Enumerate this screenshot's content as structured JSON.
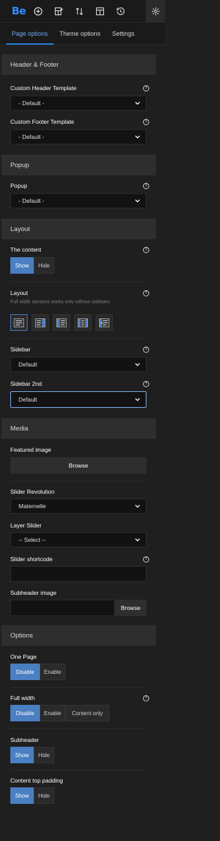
{
  "topbar": {
    "logo": "Be",
    "icons": [
      "plus-circle-icon",
      "add-section-icon",
      "sort-icon",
      "template-icon",
      "history-icon",
      "gear-icon"
    ]
  },
  "tabs": [
    "Page options",
    "Theme options",
    "Settings"
  ],
  "sections": {
    "header_footer": {
      "title": "Header & Footer",
      "custom_header": {
        "label": "Custom Header Template",
        "value": "- Default -"
      },
      "custom_footer": {
        "label": "Custom Footer Template",
        "value": "- Default -"
      }
    },
    "popup": {
      "title": "Popup",
      "popup": {
        "label": "Popup",
        "value": "- Default -"
      }
    },
    "layout": {
      "title": "Layout",
      "content": {
        "label": "The content",
        "options": [
          "Show",
          "Hide"
        ],
        "selected": "Show"
      },
      "layout": {
        "label": "Layout",
        "hint": "Full width sections works only without sidebars"
      },
      "sidebar": {
        "label": "Sidebar",
        "value": "Default"
      },
      "sidebar2": {
        "label": "Sidebar 2nd",
        "value": "Default"
      }
    },
    "media": {
      "title": "Media",
      "featured": {
        "label": "Featured image",
        "button": "Browse"
      },
      "slider_rev": {
        "label": "Slider Revolution",
        "value": "Maternelle"
      },
      "layer_slider": {
        "label": "Layer Slider",
        "value": "-- Select --"
      },
      "slider_shortcode": {
        "label": "Slider shortcode",
        "value": ""
      },
      "subheader_image": {
        "label": "Subheader image",
        "button": "Browse"
      }
    },
    "options": {
      "title": "Options",
      "one_page": {
        "label": "One Page",
        "options": [
          "Disable",
          "Enable"
        ],
        "selected": "Disable"
      },
      "full_width": {
        "label": "Full width",
        "options": [
          "Disable",
          "Enable",
          "Content only"
        ],
        "selected": "Disable"
      },
      "subheader": {
        "label": "Subheader",
        "options": [
          "Show",
          "Hide"
        ],
        "selected": "Show"
      },
      "content_top_padding": {
        "label": "Content top padding",
        "options": [
          "Show",
          "Hide"
        ],
        "selected": "Show"
      }
    }
  },
  "help_glyph": "?",
  "colors": {
    "accent": "#4a7fc2",
    "tab_active": "#6aa9f5",
    "logo": "#2f8cff",
    "background": "#1f1f1f",
    "section": "#2e2e2e"
  }
}
